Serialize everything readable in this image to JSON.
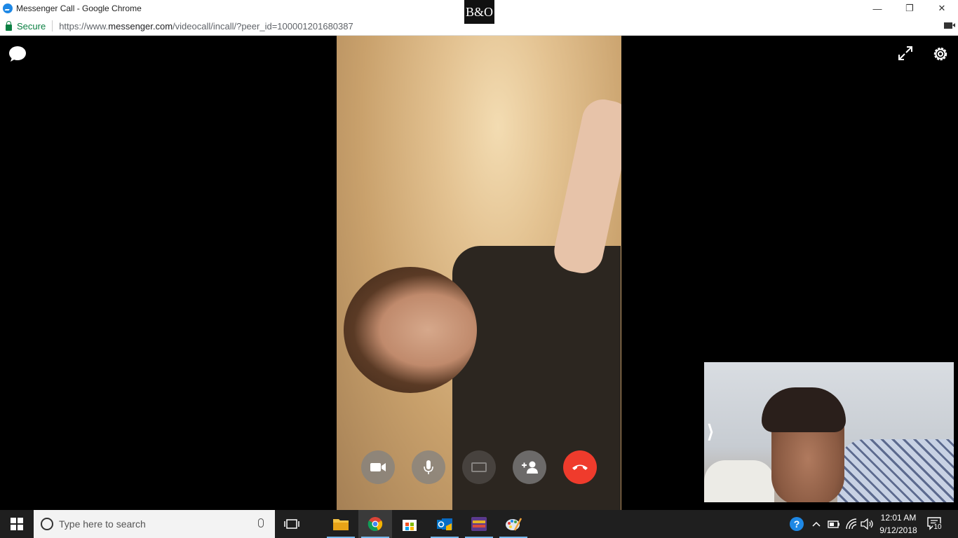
{
  "browser": {
    "window_title": "Messenger Call - Google Chrome",
    "security_label": "Secure",
    "url_prefix": "https://www.",
    "url_host": "messenger.com",
    "url_path": "/videocall/incall/?peer_id=100001201680387",
    "overlay_logo": "B&O"
  },
  "window_controls": {
    "minimize": "—",
    "restore": "❐",
    "close": "✕"
  },
  "call": {
    "self_view_toggle": "⟩",
    "controls": [
      {
        "name": "camera-toggle",
        "state": "enabled"
      },
      {
        "name": "microphone-toggle",
        "state": "enabled"
      },
      {
        "name": "screen-share",
        "state": "disabled"
      },
      {
        "name": "add-person",
        "state": "enabled"
      },
      {
        "name": "end-call",
        "state": "enabled"
      }
    ],
    "colors": {
      "end_call": "#ef3b2c",
      "control_bg": "#828282"
    }
  },
  "taskbar": {
    "search_placeholder": "Type here to search",
    "pinned_apps": [
      "file-explorer",
      "google-chrome",
      "microsoft-store",
      "outlook",
      "game-app",
      "paint"
    ],
    "active_app": "google-chrome",
    "clock_time": "12:01 AM",
    "clock_date": "9/12/2018",
    "notification_count": "10"
  }
}
